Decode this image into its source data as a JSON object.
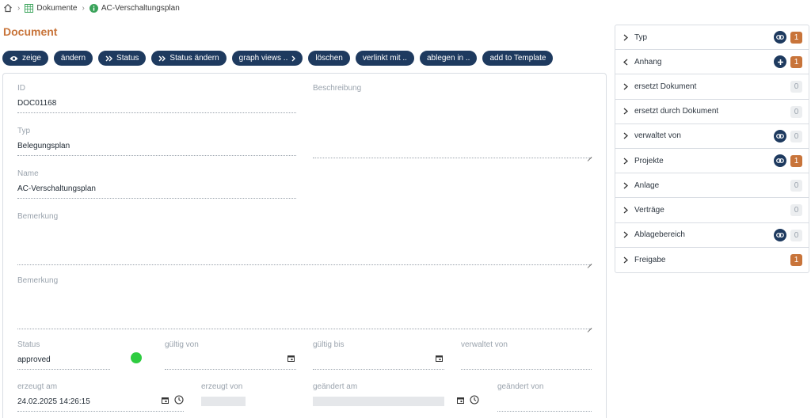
{
  "breadcrumb": {
    "items": [
      "Dokumente",
      "AC-Verschaltungsplan"
    ]
  },
  "page": {
    "title": "Document"
  },
  "toolbar": {
    "buttons": [
      "zeige",
      "ändern",
      "Status",
      "Status ändern",
      "graph views ..",
      "löschen",
      "verlinkt mit ..",
      "ablegen in ..",
      "add to Template"
    ]
  },
  "form": {
    "id": {
      "label": "ID",
      "value": "DOC01168"
    },
    "typ": {
      "label": "Typ",
      "value": "Belegungsplan"
    },
    "name": {
      "label": "Name",
      "value": "AC-Verschaltungsplan"
    },
    "beschreibung": {
      "label": "Beschreibung",
      "value": ""
    },
    "bemerkung1": {
      "label": "Bemerkung",
      "value": ""
    },
    "bemerkung2": {
      "label": "Bemerkung",
      "value": ""
    },
    "status": {
      "label": "Status",
      "value": "approved",
      "color": "#2ecc40"
    },
    "gueltig_von": {
      "label": "gültig von",
      "value": ""
    },
    "gueltig_bis": {
      "label": "gültig bis",
      "value": ""
    },
    "verwaltet_von": {
      "label": "verwaltet von",
      "value": ""
    },
    "erzeugt_am": {
      "label": "erzeugt am",
      "value": "24.02.2025 14:26:15"
    },
    "erzeugt_von": {
      "label": "erzeugt von",
      "value": ""
    },
    "geaendert_am": {
      "label": "geändert am",
      "value": ""
    },
    "geaendert_von": {
      "label": "geändert von",
      "value": ""
    }
  },
  "side": {
    "items": [
      {
        "label": "Typ",
        "count": "1",
        "icon": "link-icon",
        "expanded": false
      },
      {
        "label": "Anhang",
        "count": "1",
        "icon": "plus-icon",
        "expanded": true
      },
      {
        "label": "ersetzt Dokument",
        "count": "0",
        "icon": "",
        "expanded": false
      },
      {
        "label": "ersetzt durch Dokument",
        "count": "0",
        "icon": "",
        "expanded": false
      },
      {
        "label": "verwaltet von",
        "count": "0",
        "icon": "link-icon",
        "expanded": false
      },
      {
        "label": "Projekte",
        "count": "1",
        "icon": "link-icon",
        "expanded": false
      },
      {
        "label": "Anlage",
        "count": "0",
        "icon": "",
        "expanded": false
      },
      {
        "label": "Verträge",
        "count": "0",
        "icon": "",
        "expanded": false
      },
      {
        "label": "Ablagebereich",
        "count": "0",
        "icon": "link-icon",
        "expanded": false
      },
      {
        "label": "Freigabe",
        "count": "1",
        "icon": "",
        "expanded": false
      }
    ]
  },
  "colors": {
    "accent": "#c8743a",
    "button": "#1e3a5f",
    "status_ok": "#2ecc40"
  }
}
